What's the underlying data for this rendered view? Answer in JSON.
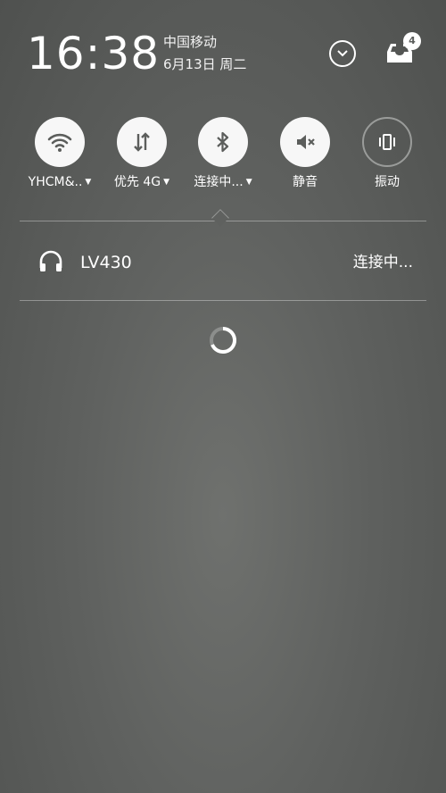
{
  "status": {
    "time": "16:38",
    "carrier": "中国移动",
    "date": "6月13日 周二",
    "notification_count": "4"
  },
  "toggles": [
    {
      "label": "YHCM&..",
      "icon": "wifi-icon",
      "active": true,
      "has_dropdown": true
    },
    {
      "label": "优先 4G",
      "icon": "mobile-data-icon",
      "active": true,
      "has_dropdown": true
    },
    {
      "label": "连接中...",
      "icon": "bluetooth-icon",
      "active": true,
      "has_dropdown": true
    },
    {
      "label": "静音",
      "icon": "mute-icon",
      "active": true,
      "has_dropdown": false
    },
    {
      "label": "振动",
      "icon": "vibrate-icon",
      "active": false,
      "has_dropdown": false
    }
  ],
  "bluetooth_panel": {
    "device_icon": "headphones-icon",
    "device_name": "LV430",
    "device_status": "连接中...",
    "loading": true
  },
  "colors": {
    "background": "#616361",
    "toggle_active": "#f7f7f7",
    "toggle_icon": "#5c5e5c",
    "text": "#ffffff"
  }
}
